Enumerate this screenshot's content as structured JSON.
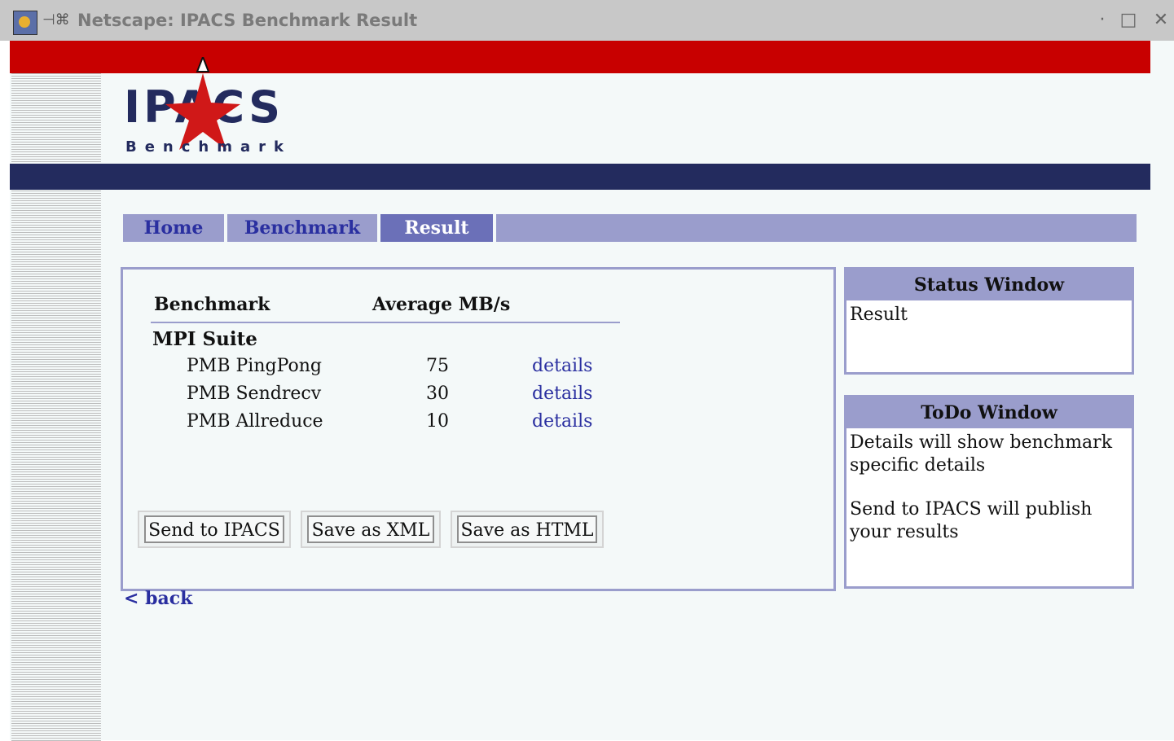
{
  "window": {
    "title": "Netscape: IPACS Benchmark Result",
    "minimize_glyph": "·",
    "maximize_glyph": "□",
    "close_glyph": "✕"
  },
  "logo": {
    "main": "IPACS",
    "sub": "Benchmark"
  },
  "tabs": [
    {
      "label": "Home"
    },
    {
      "label": "Benchmark"
    },
    {
      "label": "Result",
      "active": true
    }
  ],
  "results": {
    "header_benchmark": "Benchmark",
    "header_average": "Average MB/s",
    "suite": "MPI Suite",
    "rows": [
      {
        "name": "PMB PingPong",
        "value": "75",
        "link": "details"
      },
      {
        "name": "PMB Sendrecv",
        "value": "30",
        "link": "details"
      },
      {
        "name": "PMB Allreduce",
        "value": "10",
        "link": "details"
      }
    ]
  },
  "buttons": {
    "send": "Send to IPACS",
    "xml": "Save as XML",
    "html": "Save as HTML"
  },
  "back_link": "< back",
  "status_window": {
    "title": "Status Window",
    "text": "Result"
  },
  "todo_window": {
    "title": "ToDo Window",
    "text1": "Details will show benchmark specific details",
    "text2": "Send to IPACS will publish your results"
  },
  "colors": {
    "red_band": "#c80000",
    "navy_band": "#232b5e",
    "tab_bg": "#9a9dcc",
    "tab_active": "#6b70b8",
    "link": "#2a2fa0"
  }
}
